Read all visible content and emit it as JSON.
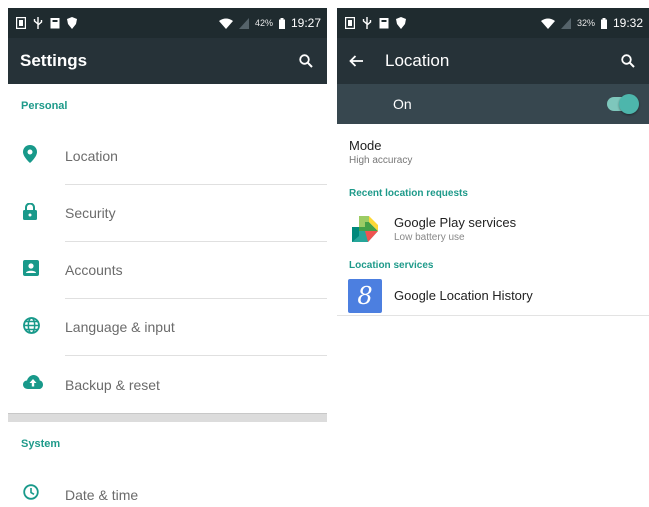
{
  "left_screen": {
    "statusbar": {
      "battery": "42%",
      "time": "19:27"
    },
    "appbar": {
      "title": "Settings",
      "search_icon": "search-icon"
    },
    "sections": [
      {
        "header": "Personal",
        "items": [
          {
            "label": "Location",
            "icon": "location-pin-icon"
          },
          {
            "label": "Security",
            "icon": "lock-icon"
          },
          {
            "label": "Accounts",
            "icon": "account-icon"
          },
          {
            "label": "Language & input",
            "icon": "globe-icon"
          },
          {
            "label": "Backup & reset",
            "icon": "cloud-upload-icon"
          }
        ]
      },
      {
        "header": "System",
        "items": [
          {
            "label": "Date & time",
            "icon": "clock-icon"
          }
        ]
      }
    ]
  },
  "right_screen": {
    "statusbar": {
      "battery": "32%",
      "time": "19:32"
    },
    "appbar": {
      "title": "Location",
      "back_icon": "back-arrow-icon",
      "search_icon": "search-icon"
    },
    "master_switch": {
      "label": "On",
      "state": true
    },
    "mode": {
      "title": "Mode",
      "value": "High accuracy"
    },
    "recent_requests": {
      "header": "Recent location requests",
      "apps": [
        {
          "name": "Google Play services",
          "subtitle": "Low battery use",
          "icon": "google-play-services-icon"
        }
      ]
    },
    "location_services": {
      "header": "Location services",
      "items": [
        {
          "name": "Google Location History",
          "icon": "google-location-history-icon",
          "icon_letter": "8"
        }
      ]
    }
  },
  "colors": {
    "statusbar": "#1f2b2f",
    "appbar": "#263238",
    "switchbar": "#37474f",
    "accent": "#1e9a8a",
    "toggle_on": "#4db6ac"
  }
}
